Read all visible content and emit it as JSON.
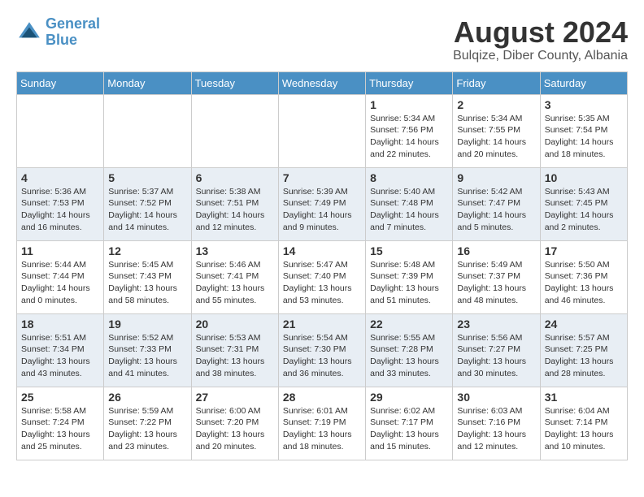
{
  "header": {
    "logo_line1": "General",
    "logo_line2": "Blue",
    "month_year": "August 2024",
    "location": "Bulqize, Diber County, Albania"
  },
  "weekdays": [
    "Sunday",
    "Monday",
    "Tuesday",
    "Wednesday",
    "Thursday",
    "Friday",
    "Saturday"
  ],
  "weeks": [
    [
      {
        "day": "",
        "info": ""
      },
      {
        "day": "",
        "info": ""
      },
      {
        "day": "",
        "info": ""
      },
      {
        "day": "",
        "info": ""
      },
      {
        "day": "1",
        "info": "Sunrise: 5:34 AM\nSunset: 7:56 PM\nDaylight: 14 hours\nand 22 minutes."
      },
      {
        "day": "2",
        "info": "Sunrise: 5:34 AM\nSunset: 7:55 PM\nDaylight: 14 hours\nand 20 minutes."
      },
      {
        "day": "3",
        "info": "Sunrise: 5:35 AM\nSunset: 7:54 PM\nDaylight: 14 hours\nand 18 minutes."
      }
    ],
    [
      {
        "day": "4",
        "info": "Sunrise: 5:36 AM\nSunset: 7:53 PM\nDaylight: 14 hours\nand 16 minutes."
      },
      {
        "day": "5",
        "info": "Sunrise: 5:37 AM\nSunset: 7:52 PM\nDaylight: 14 hours\nand 14 minutes."
      },
      {
        "day": "6",
        "info": "Sunrise: 5:38 AM\nSunset: 7:51 PM\nDaylight: 14 hours\nand 12 minutes."
      },
      {
        "day": "7",
        "info": "Sunrise: 5:39 AM\nSunset: 7:49 PM\nDaylight: 14 hours\nand 9 minutes."
      },
      {
        "day": "8",
        "info": "Sunrise: 5:40 AM\nSunset: 7:48 PM\nDaylight: 14 hours\nand 7 minutes."
      },
      {
        "day": "9",
        "info": "Sunrise: 5:42 AM\nSunset: 7:47 PM\nDaylight: 14 hours\nand 5 minutes."
      },
      {
        "day": "10",
        "info": "Sunrise: 5:43 AM\nSunset: 7:45 PM\nDaylight: 14 hours\nand 2 minutes."
      }
    ],
    [
      {
        "day": "11",
        "info": "Sunrise: 5:44 AM\nSunset: 7:44 PM\nDaylight: 14 hours\nand 0 minutes."
      },
      {
        "day": "12",
        "info": "Sunrise: 5:45 AM\nSunset: 7:43 PM\nDaylight: 13 hours\nand 58 minutes."
      },
      {
        "day": "13",
        "info": "Sunrise: 5:46 AM\nSunset: 7:41 PM\nDaylight: 13 hours\nand 55 minutes."
      },
      {
        "day": "14",
        "info": "Sunrise: 5:47 AM\nSunset: 7:40 PM\nDaylight: 13 hours\nand 53 minutes."
      },
      {
        "day": "15",
        "info": "Sunrise: 5:48 AM\nSunset: 7:39 PM\nDaylight: 13 hours\nand 51 minutes."
      },
      {
        "day": "16",
        "info": "Sunrise: 5:49 AM\nSunset: 7:37 PM\nDaylight: 13 hours\nand 48 minutes."
      },
      {
        "day": "17",
        "info": "Sunrise: 5:50 AM\nSunset: 7:36 PM\nDaylight: 13 hours\nand 46 minutes."
      }
    ],
    [
      {
        "day": "18",
        "info": "Sunrise: 5:51 AM\nSunset: 7:34 PM\nDaylight: 13 hours\nand 43 minutes."
      },
      {
        "day": "19",
        "info": "Sunrise: 5:52 AM\nSunset: 7:33 PM\nDaylight: 13 hours\nand 41 minutes."
      },
      {
        "day": "20",
        "info": "Sunrise: 5:53 AM\nSunset: 7:31 PM\nDaylight: 13 hours\nand 38 minutes."
      },
      {
        "day": "21",
        "info": "Sunrise: 5:54 AM\nSunset: 7:30 PM\nDaylight: 13 hours\nand 36 minutes."
      },
      {
        "day": "22",
        "info": "Sunrise: 5:55 AM\nSunset: 7:28 PM\nDaylight: 13 hours\nand 33 minutes."
      },
      {
        "day": "23",
        "info": "Sunrise: 5:56 AM\nSunset: 7:27 PM\nDaylight: 13 hours\nand 30 minutes."
      },
      {
        "day": "24",
        "info": "Sunrise: 5:57 AM\nSunset: 7:25 PM\nDaylight: 13 hours\nand 28 minutes."
      }
    ],
    [
      {
        "day": "25",
        "info": "Sunrise: 5:58 AM\nSunset: 7:24 PM\nDaylight: 13 hours\nand 25 minutes."
      },
      {
        "day": "26",
        "info": "Sunrise: 5:59 AM\nSunset: 7:22 PM\nDaylight: 13 hours\nand 23 minutes."
      },
      {
        "day": "27",
        "info": "Sunrise: 6:00 AM\nSunset: 7:20 PM\nDaylight: 13 hours\nand 20 minutes."
      },
      {
        "day": "28",
        "info": "Sunrise: 6:01 AM\nSunset: 7:19 PM\nDaylight: 13 hours\nand 18 minutes."
      },
      {
        "day": "29",
        "info": "Sunrise: 6:02 AM\nSunset: 7:17 PM\nDaylight: 13 hours\nand 15 minutes."
      },
      {
        "day": "30",
        "info": "Sunrise: 6:03 AM\nSunset: 7:16 PM\nDaylight: 13 hours\nand 12 minutes."
      },
      {
        "day": "31",
        "info": "Sunrise: 6:04 AM\nSunset: 7:14 PM\nDaylight: 13 hours\nand 10 minutes."
      }
    ]
  ]
}
